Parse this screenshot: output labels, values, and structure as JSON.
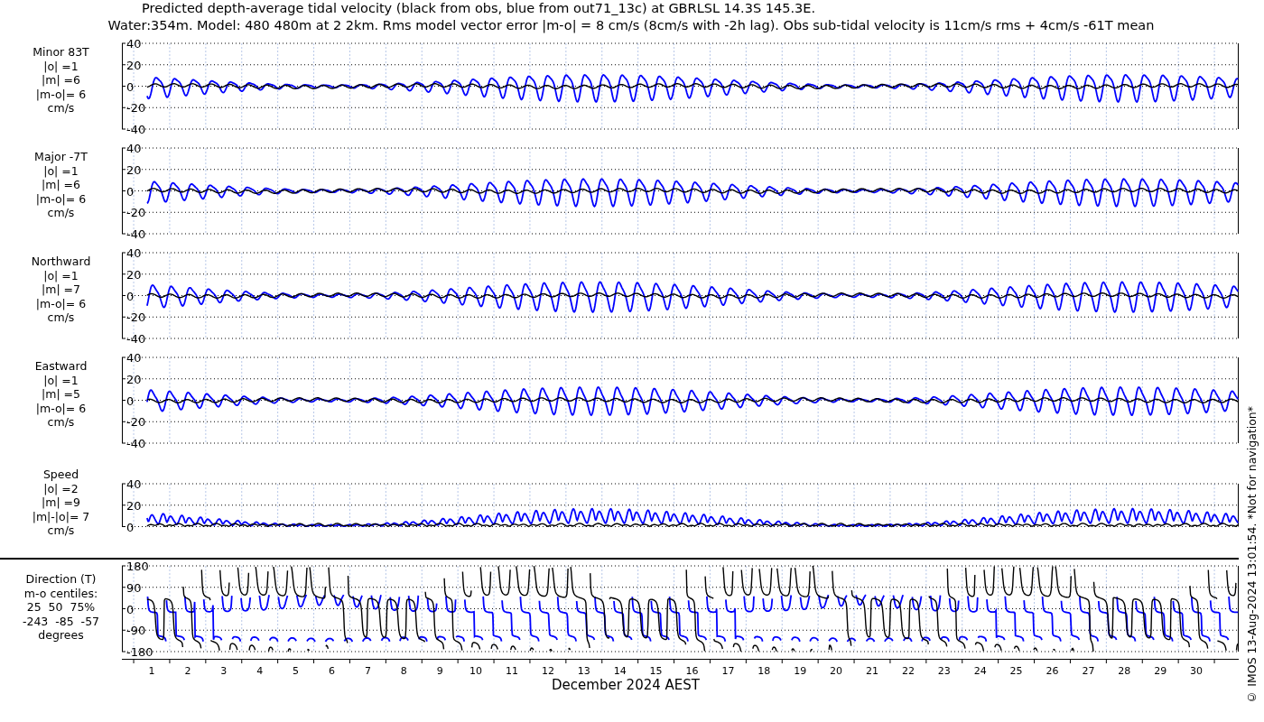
{
  "title": {
    "line_1": "Predicted depth-average tidal velocity (black from obs, blue from out71_13c) at GBRLSL 14.3S 145.3E.",
    "line_2": "Water:354m. Model: 480 480m at 2 2km. Rms model vector error |m-o| = 8 cm/s (8cm/s with -2h lag). Obs sub-tidal velocity is 11cm/s rms + 4cm/s -61T mean"
  },
  "panels": [
    {
      "kind": "velocity",
      "label_lines": [
        "Minor 83T",
        "|o| =1",
        "|m| =6",
        "|m-o|= 6",
        "cm/s"
      ],
      "y_ticks": [
        "40",
        "20",
        "0",
        "-20",
        "-40"
      ]
    },
    {
      "kind": "velocity",
      "label_lines": [
        "Major -7T",
        "|o| =1",
        "|m| =6",
        "|m-o|= 6",
        "cm/s"
      ],
      "y_ticks": [
        "40",
        "20",
        "0",
        "-20",
        "-40"
      ]
    },
    {
      "kind": "velocity",
      "label_lines": [
        "Northward",
        "|o| =1",
        "|m| =7",
        "|m-o|= 6",
        "cm/s"
      ],
      "y_ticks": [
        "40",
        "20",
        "0",
        "-20",
        "-40"
      ]
    },
    {
      "kind": "velocity",
      "label_lines": [
        "Eastward",
        "|o| =1",
        "|m| =5",
        "|m-o|= 6",
        "cm/s"
      ],
      "y_ticks": [
        "40",
        "20",
        "0",
        "-20",
        "-40"
      ]
    },
    {
      "kind": "speed",
      "label_lines": [
        "Speed",
        "|o| =2",
        "|m| =9",
        "|m|-|o|= 7",
        "cm/s"
      ],
      "y_ticks": [
        "40",
        "20",
        "0"
      ]
    },
    {
      "kind": "direction",
      "label_lines": [
        "Direction (T)",
        "m-o centiles:",
        "25  50  75%",
        "-243  -85  -57",
        "degrees"
      ],
      "y_ticks": [
        "180",
        "90",
        "0",
        "-90",
        "-180"
      ]
    }
  ],
  "x_axis": {
    "ticks": [
      "1",
      "2",
      "3",
      "4",
      "5",
      "6",
      "7",
      "8",
      "9",
      "10",
      "11",
      "12",
      "13",
      "14",
      "15",
      "16",
      "17",
      "18",
      "19",
      "20",
      "21",
      "22",
      "23",
      "24",
      "25",
      "26",
      "27",
      "28",
      "29",
      "30"
    ],
    "label": "December 2024 AEST"
  },
  "side_note": "© IMOS 13-Aug-2024 13:01:54. *Not for navigation*"
}
